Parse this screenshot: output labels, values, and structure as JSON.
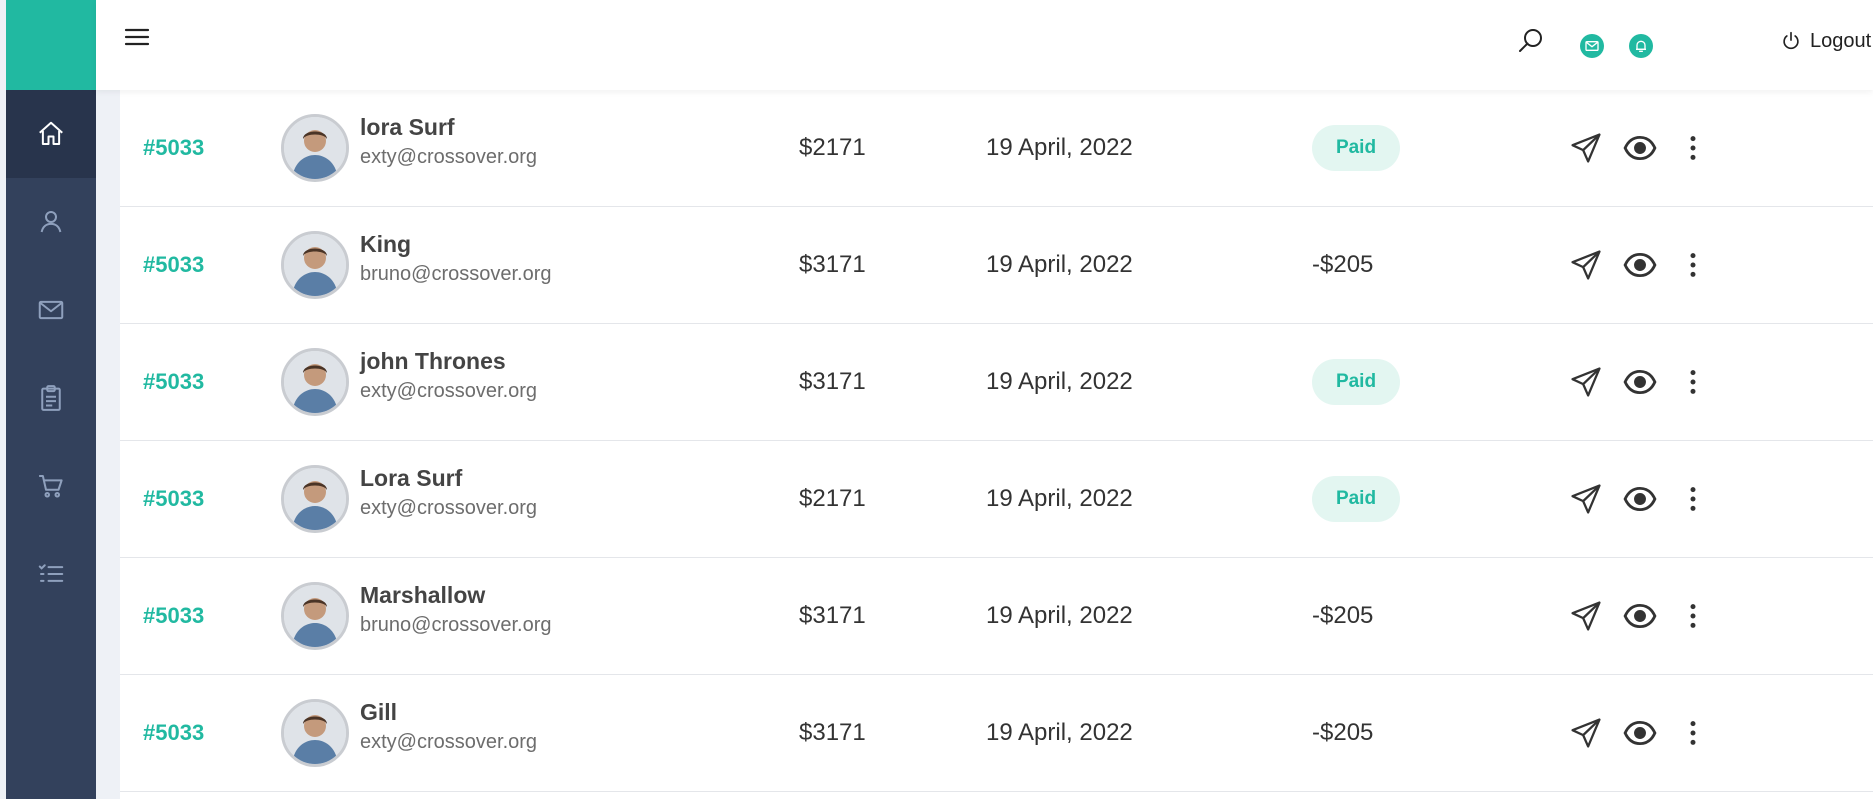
{
  "sidebar": {
    "items": [
      {
        "icon": "home-icon",
        "active": true
      },
      {
        "icon": "user-icon",
        "active": false
      },
      {
        "icon": "mail-icon",
        "active": false
      },
      {
        "icon": "clipboard-icon",
        "active": false
      },
      {
        "icon": "cart-icon",
        "active": false
      },
      {
        "icon": "checklist-icon",
        "active": false
      }
    ]
  },
  "header": {
    "logout_label": "Logout"
  },
  "invoices": [
    {
      "id": "#5033",
      "name": "lora Surf",
      "email": "exty@crossover.org",
      "amount": "$2171",
      "date": "19 April, 2022",
      "status": "Paid",
      "status_type": "pill"
    },
    {
      "id": "#5033",
      "name": "King",
      "email": "bruno@crossover.org",
      "amount": "$3171",
      "date": "19 April, 2022",
      "status": "-$205",
      "status_type": "text"
    },
    {
      "id": "#5033",
      "name": "john Thrones",
      "email": "exty@crossover.org",
      "amount": "$3171",
      "date": "19 April, 2022",
      "status": "Paid",
      "status_type": "pill"
    },
    {
      "id": "#5033",
      "name": "Lora Surf",
      "email": "exty@crossover.org",
      "amount": "$2171",
      "date": "19 April, 2022",
      "status": "Paid",
      "status_type": "pill"
    },
    {
      "id": "#5033",
      "name": "Marshallow",
      "email": "bruno@crossover.org",
      "amount": "$3171",
      "date": "19 April, 2022",
      "status": "-$205",
      "status_type": "text"
    },
    {
      "id": "#5033",
      "name": "Gill",
      "email": "exty@crossover.org",
      "amount": "$3171",
      "date": "19 April, 2022",
      "status": "-$205",
      "status_type": "text"
    }
  ],
  "colors": {
    "accent": "#21b9a1",
    "sidebar": "#33415c",
    "pill_bg": "#e3f6f1"
  }
}
